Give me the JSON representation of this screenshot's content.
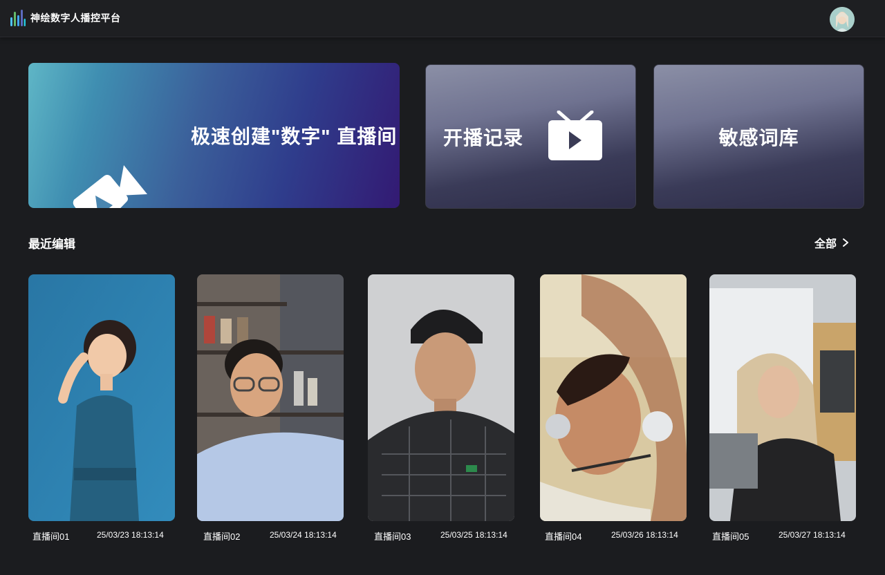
{
  "app": {
    "title": "神绘数字人播控平台",
    "logo_icon": "bar-logo-icon",
    "avatar_icon": "user-avatar"
  },
  "actions": {
    "create": {
      "label": "极速创建\"数字\" 直播间",
      "icon": "video-camera-icon"
    },
    "record": {
      "label": "开播记录",
      "icon": "tv-play-icon"
    },
    "words": {
      "label": "敏感词库"
    }
  },
  "recent": {
    "title": "最近编辑",
    "view_all": "全部",
    "view_all_icon": "chevron-right-icon",
    "items": [
      {
        "name": "直播间01",
        "time": "25/03/23 18:13:14"
      },
      {
        "name": "直播间02",
        "time": "25/03/24 18:13:14"
      },
      {
        "name": "直播间03",
        "time": "25/03/25 18:13:14"
      },
      {
        "name": "直播间04",
        "time": "25/03/26 18:13:14"
      },
      {
        "name": "直播间05",
        "time": "25/03/27 18:13:14"
      }
    ]
  },
  "colors": {
    "background": "#1b1c1f",
    "topbar": "#1e1f22",
    "create_gradient_start": "#5fb6c6",
    "create_gradient_end": "#331a73"
  }
}
